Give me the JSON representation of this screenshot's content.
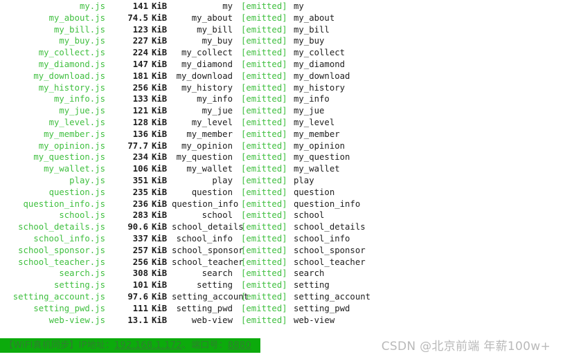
{
  "terminal": {
    "kind": "webpack-build-asset-list",
    "colors": {
      "asset_name": "#3fbf3f",
      "size_text": "#1d1d1d",
      "chunk_name": "#1d1d1d",
      "emitted_marker": "#3fbf3f",
      "status_bar_background": "#0cab0c",
      "status_bar_text": "#2f7f2f",
      "watermark_text": "#b9b9b9",
      "page_background": "#ffffff"
    },
    "emitted_label": "[emitted]",
    "size_unit": "KiB",
    "assets": [
      {
        "file": "my.js",
        "size": "141",
        "unit": "KiB",
        "chunk": "my",
        "emitted": "[emitted]",
        "names": "my"
      },
      {
        "file": "my_about.js",
        "size": "74.5",
        "unit": "KiB",
        "chunk": "my_about",
        "emitted": "[emitted]",
        "names": "my_about"
      },
      {
        "file": "my_bill.js",
        "size": "123",
        "unit": "KiB",
        "chunk": "my_bill",
        "emitted": "[emitted]",
        "names": "my_bill"
      },
      {
        "file": "my_buy.js",
        "size": "227",
        "unit": "KiB",
        "chunk": "my_buy",
        "emitted": "[emitted]",
        "names": "my_buy"
      },
      {
        "file": "my_collect.js",
        "size": "224",
        "unit": "KiB",
        "chunk": "my_collect",
        "emitted": "[emitted]",
        "names": "my_collect"
      },
      {
        "file": "my_diamond.js",
        "size": "147",
        "unit": "KiB",
        "chunk": "my_diamond",
        "emitted": "[emitted]",
        "names": "my_diamond"
      },
      {
        "file": "my_download.js",
        "size": "181",
        "unit": "KiB",
        "chunk": "my_download",
        "emitted": "[emitted]",
        "names": "my_download"
      },
      {
        "file": "my_history.js",
        "size": "256",
        "unit": "KiB",
        "chunk": "my_history",
        "emitted": "[emitted]",
        "names": "my_history"
      },
      {
        "file": "my_info.js",
        "size": "133",
        "unit": "KiB",
        "chunk": "my_info",
        "emitted": "[emitted]",
        "names": "my_info"
      },
      {
        "file": "my_jue.js",
        "size": "121",
        "unit": "KiB",
        "chunk": "my_jue",
        "emitted": "[emitted]",
        "names": "my_jue"
      },
      {
        "file": "my_level.js",
        "size": "128",
        "unit": "KiB",
        "chunk": "my_level",
        "emitted": "[emitted]",
        "names": "my_level"
      },
      {
        "file": "my_member.js",
        "size": "136",
        "unit": "KiB",
        "chunk": "my_member",
        "emitted": "[emitted]",
        "names": "my_member"
      },
      {
        "file": "my_opinion.js",
        "size": "77.7",
        "unit": "KiB",
        "chunk": "my_opinion",
        "emitted": "[emitted]",
        "names": "my_opinion"
      },
      {
        "file": "my_question.js",
        "size": "234",
        "unit": "KiB",
        "chunk": "my_question",
        "emitted": "[emitted]",
        "names": "my_question"
      },
      {
        "file": "my_wallet.js",
        "size": "106",
        "unit": "KiB",
        "chunk": "my_wallet",
        "emitted": "[emitted]",
        "names": "my_wallet"
      },
      {
        "file": "play.js",
        "size": "351",
        "unit": "KiB",
        "chunk": "play",
        "emitted": "[emitted]",
        "names": "play"
      },
      {
        "file": "question.js",
        "size": "235",
        "unit": "KiB",
        "chunk": "question",
        "emitted": "[emitted]",
        "names": "question"
      },
      {
        "file": "question_info.js",
        "size": "236",
        "unit": "KiB",
        "chunk": "question_info",
        "emitted": "[emitted]",
        "names": "question_info"
      },
      {
        "file": "school.js",
        "size": "283",
        "unit": "KiB",
        "chunk": "school",
        "emitted": "[emitted]",
        "names": "school"
      },
      {
        "file": "school_details.js",
        "size": "90.6",
        "unit": "KiB",
        "chunk": "school_details",
        "emitted": "[emitted]",
        "names": "school_details"
      },
      {
        "file": "school_info.js",
        "size": "337",
        "unit": "KiB",
        "chunk": "school_info",
        "emitted": "[emitted]",
        "names": "school_info"
      },
      {
        "file": "school_sponsor.js",
        "size": "257",
        "unit": "KiB",
        "chunk": "school_sponsor",
        "emitted": "[emitted]",
        "names": "school_sponsor"
      },
      {
        "file": "school_teacher.js",
        "size": "256",
        "unit": "KiB",
        "chunk": "school_teacher",
        "emitted": "[emitted]",
        "names": "school_teacher"
      },
      {
        "file": "search.js",
        "size": "308",
        "unit": "KiB",
        "chunk": "search",
        "emitted": "[emitted]",
        "names": "search"
      },
      {
        "file": "setting.js",
        "size": "101",
        "unit": "KiB",
        "chunk": "setting",
        "emitted": "[emitted]",
        "names": "setting"
      },
      {
        "file": "setting_account.js",
        "size": "97.6",
        "unit": "KiB",
        "chunk": "setting_account",
        "emitted": "[emitted]",
        "names": "setting_account"
      },
      {
        "file": "setting_pwd.js",
        "size": "111",
        "unit": "KiB",
        "chunk": "setting_pwd",
        "emitted": "[emitted]",
        "names": "setting_pwd"
      },
      {
        "file": "web-view.js",
        "size": "13.1",
        "unit": "KiB",
        "chunk": "web-view",
        "emitted": "[emitted]",
        "names": "web-view"
      }
    ]
  },
  "status_bar": {
    "prefix": "【WiFI真机同步】IP地址：",
    "ip": "192.168.1.172",
    "separator": "、端口号：",
    "port": "8880"
  },
  "watermark": {
    "text": "CSDN @北京前端 年薪100w+"
  }
}
